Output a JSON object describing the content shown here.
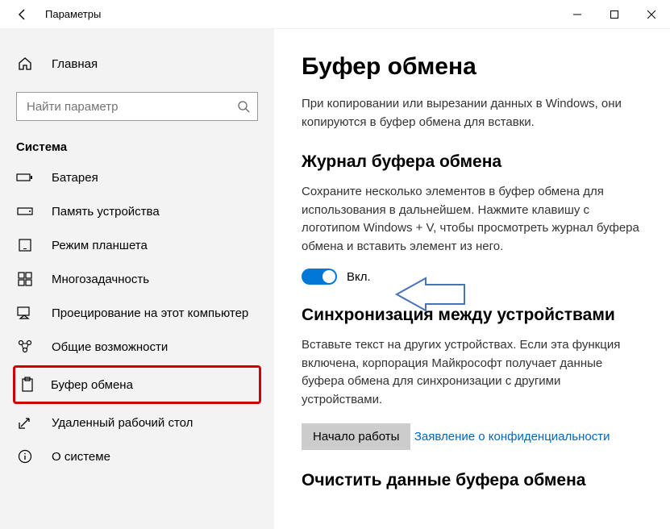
{
  "window": {
    "title": "Параметры"
  },
  "sidebar": {
    "home": "Главная",
    "search_placeholder": "Найти параметр",
    "section": "Система",
    "items": [
      {
        "label": "Батарея"
      },
      {
        "label": "Память устройства"
      },
      {
        "label": "Режим планшета"
      },
      {
        "label": "Многозадачность"
      },
      {
        "label": "Проецирование на этот компьютер"
      },
      {
        "label": "Общие возможности"
      },
      {
        "label": "Буфер обмена"
      },
      {
        "label": "Удаленный рабочий стол"
      },
      {
        "label": "О системе"
      }
    ]
  },
  "main": {
    "title": "Буфер обмена",
    "intro": "При копировании или вырезании данных в Windows, они копируются в буфер обмена для вставки.",
    "history_h": "Журнал буфера обмена",
    "history_p": "Сохраните несколько элементов в буфер обмена для использования в дальнейшем. Нажмите клавишу с логотипом Windows + V, чтобы просмотреть журнал буфера обмена и вставить элемент из него.",
    "toggle_label": "Вкл.",
    "sync_h": "Синхронизация между устройствами",
    "sync_p": "Вставьте текст на других устройствах. Если эта функция включена, корпорация Майкрософт получает данные буфера обмена для синхронизации с другими устройствами.",
    "sync_btn": "Начало работы",
    "privacy_link": "Заявление о конфиденциальности",
    "clear_h": "Очистить данные буфера обмена"
  }
}
